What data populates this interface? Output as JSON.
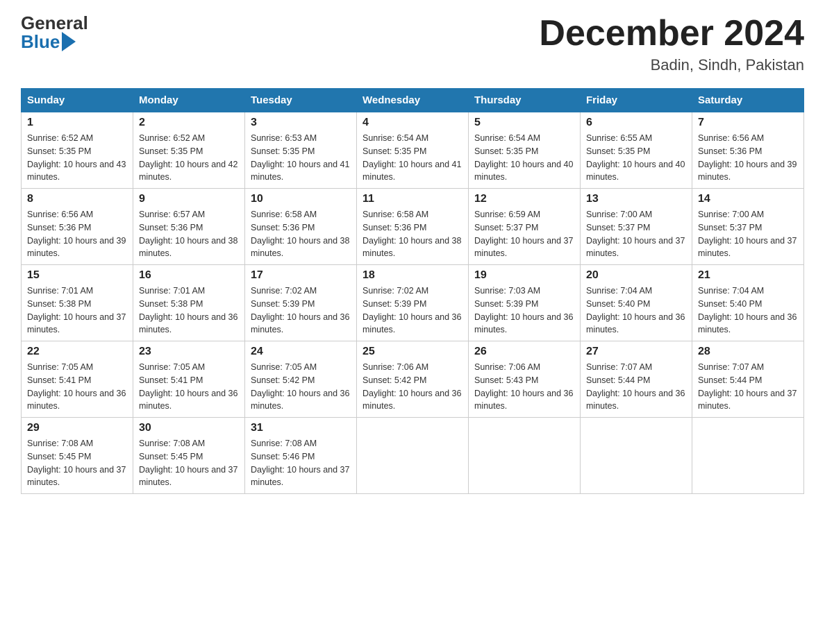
{
  "logo": {
    "general": "General",
    "blue": "Blue"
  },
  "title": "December 2024",
  "subtitle": "Badin, Sindh, Pakistan",
  "days_of_week": [
    "Sunday",
    "Monday",
    "Tuesday",
    "Wednesday",
    "Thursday",
    "Friday",
    "Saturday"
  ],
  "weeks": [
    [
      {
        "day": "1",
        "sunrise": "6:52 AM",
        "sunset": "5:35 PM",
        "daylight": "10 hours and 43 minutes."
      },
      {
        "day": "2",
        "sunrise": "6:52 AM",
        "sunset": "5:35 PM",
        "daylight": "10 hours and 42 minutes."
      },
      {
        "day": "3",
        "sunrise": "6:53 AM",
        "sunset": "5:35 PM",
        "daylight": "10 hours and 41 minutes."
      },
      {
        "day": "4",
        "sunrise": "6:54 AM",
        "sunset": "5:35 PM",
        "daylight": "10 hours and 41 minutes."
      },
      {
        "day": "5",
        "sunrise": "6:54 AM",
        "sunset": "5:35 PM",
        "daylight": "10 hours and 40 minutes."
      },
      {
        "day": "6",
        "sunrise": "6:55 AM",
        "sunset": "5:35 PM",
        "daylight": "10 hours and 40 minutes."
      },
      {
        "day": "7",
        "sunrise": "6:56 AM",
        "sunset": "5:36 PM",
        "daylight": "10 hours and 39 minutes."
      }
    ],
    [
      {
        "day": "8",
        "sunrise": "6:56 AM",
        "sunset": "5:36 PM",
        "daylight": "10 hours and 39 minutes."
      },
      {
        "day": "9",
        "sunrise": "6:57 AM",
        "sunset": "5:36 PM",
        "daylight": "10 hours and 38 minutes."
      },
      {
        "day": "10",
        "sunrise": "6:58 AM",
        "sunset": "5:36 PM",
        "daylight": "10 hours and 38 minutes."
      },
      {
        "day": "11",
        "sunrise": "6:58 AM",
        "sunset": "5:36 PM",
        "daylight": "10 hours and 38 minutes."
      },
      {
        "day": "12",
        "sunrise": "6:59 AM",
        "sunset": "5:37 PM",
        "daylight": "10 hours and 37 minutes."
      },
      {
        "day": "13",
        "sunrise": "7:00 AM",
        "sunset": "5:37 PM",
        "daylight": "10 hours and 37 minutes."
      },
      {
        "day": "14",
        "sunrise": "7:00 AM",
        "sunset": "5:37 PM",
        "daylight": "10 hours and 37 minutes."
      }
    ],
    [
      {
        "day": "15",
        "sunrise": "7:01 AM",
        "sunset": "5:38 PM",
        "daylight": "10 hours and 37 minutes."
      },
      {
        "day": "16",
        "sunrise": "7:01 AM",
        "sunset": "5:38 PM",
        "daylight": "10 hours and 36 minutes."
      },
      {
        "day": "17",
        "sunrise": "7:02 AM",
        "sunset": "5:39 PM",
        "daylight": "10 hours and 36 minutes."
      },
      {
        "day": "18",
        "sunrise": "7:02 AM",
        "sunset": "5:39 PM",
        "daylight": "10 hours and 36 minutes."
      },
      {
        "day": "19",
        "sunrise": "7:03 AM",
        "sunset": "5:39 PM",
        "daylight": "10 hours and 36 minutes."
      },
      {
        "day": "20",
        "sunrise": "7:04 AM",
        "sunset": "5:40 PM",
        "daylight": "10 hours and 36 minutes."
      },
      {
        "day": "21",
        "sunrise": "7:04 AM",
        "sunset": "5:40 PM",
        "daylight": "10 hours and 36 minutes."
      }
    ],
    [
      {
        "day": "22",
        "sunrise": "7:05 AM",
        "sunset": "5:41 PM",
        "daylight": "10 hours and 36 minutes."
      },
      {
        "day": "23",
        "sunrise": "7:05 AM",
        "sunset": "5:41 PM",
        "daylight": "10 hours and 36 minutes."
      },
      {
        "day": "24",
        "sunrise": "7:05 AM",
        "sunset": "5:42 PM",
        "daylight": "10 hours and 36 minutes."
      },
      {
        "day": "25",
        "sunrise": "7:06 AM",
        "sunset": "5:42 PM",
        "daylight": "10 hours and 36 minutes."
      },
      {
        "day": "26",
        "sunrise": "7:06 AM",
        "sunset": "5:43 PM",
        "daylight": "10 hours and 36 minutes."
      },
      {
        "day": "27",
        "sunrise": "7:07 AM",
        "sunset": "5:44 PM",
        "daylight": "10 hours and 36 minutes."
      },
      {
        "day": "28",
        "sunrise": "7:07 AM",
        "sunset": "5:44 PM",
        "daylight": "10 hours and 37 minutes."
      }
    ],
    [
      {
        "day": "29",
        "sunrise": "7:08 AM",
        "sunset": "5:45 PM",
        "daylight": "10 hours and 37 minutes."
      },
      {
        "day": "30",
        "sunrise": "7:08 AM",
        "sunset": "5:45 PM",
        "daylight": "10 hours and 37 minutes."
      },
      {
        "day": "31",
        "sunrise": "7:08 AM",
        "sunset": "5:46 PM",
        "daylight": "10 hours and 37 minutes."
      },
      null,
      null,
      null,
      null
    ]
  ]
}
